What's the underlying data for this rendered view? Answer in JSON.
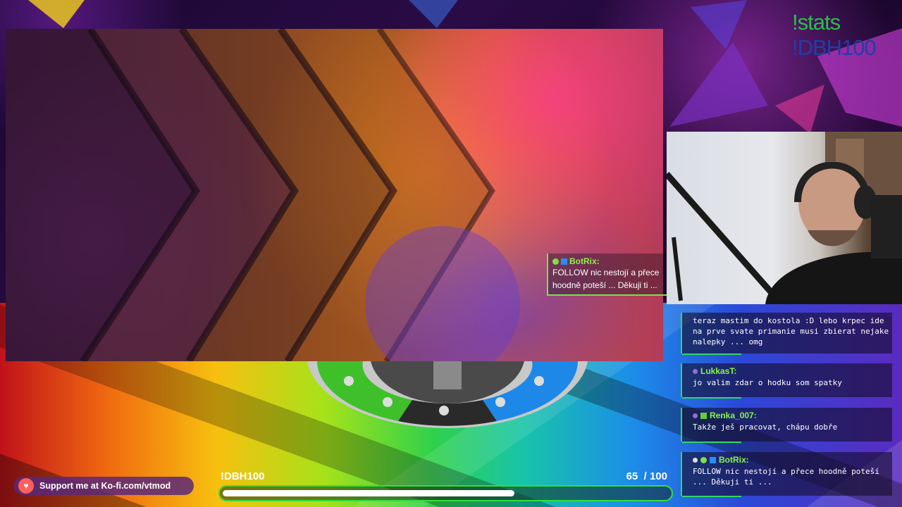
{
  "overlay": {
    "commands": [
      "!stats",
      "!DBH100"
    ],
    "game_chat": {
      "user": "BotRix:",
      "lines": [
        "FOLLOW nic nestojí a přece",
        "hoodně poteší ... Děkuji ti ..."
      ]
    }
  },
  "chat": {
    "messages": [
      {
        "user": "",
        "text": "teraz mastim do kostola :D lebo krpec ide na prve svate primanie musi zbierat nejake nalepky ... omg"
      },
      {
        "user": "LukkasT:",
        "text": "jo valim zdar o hodku som spatky"
      },
      {
        "user": "Renka_007:",
        "text": "Takže ješ pracovat, chápu dobře"
      },
      {
        "user": "BotRix:",
        "text": "FOLLOW nic nestojí a přece hoodně poteší ... Děkuji ti ..."
      }
    ]
  },
  "kofi": {
    "label": "Support me at Ko-fi.com/vtmod"
  },
  "goal": {
    "label": "!DBH100",
    "current": "65",
    "separator": "/",
    "target": "100",
    "progress_fraction": 0.65
  },
  "colors": {
    "accent_green": "#30d860",
    "username_green": "#8cf24a",
    "kofi_red": "#ff5e5b"
  }
}
